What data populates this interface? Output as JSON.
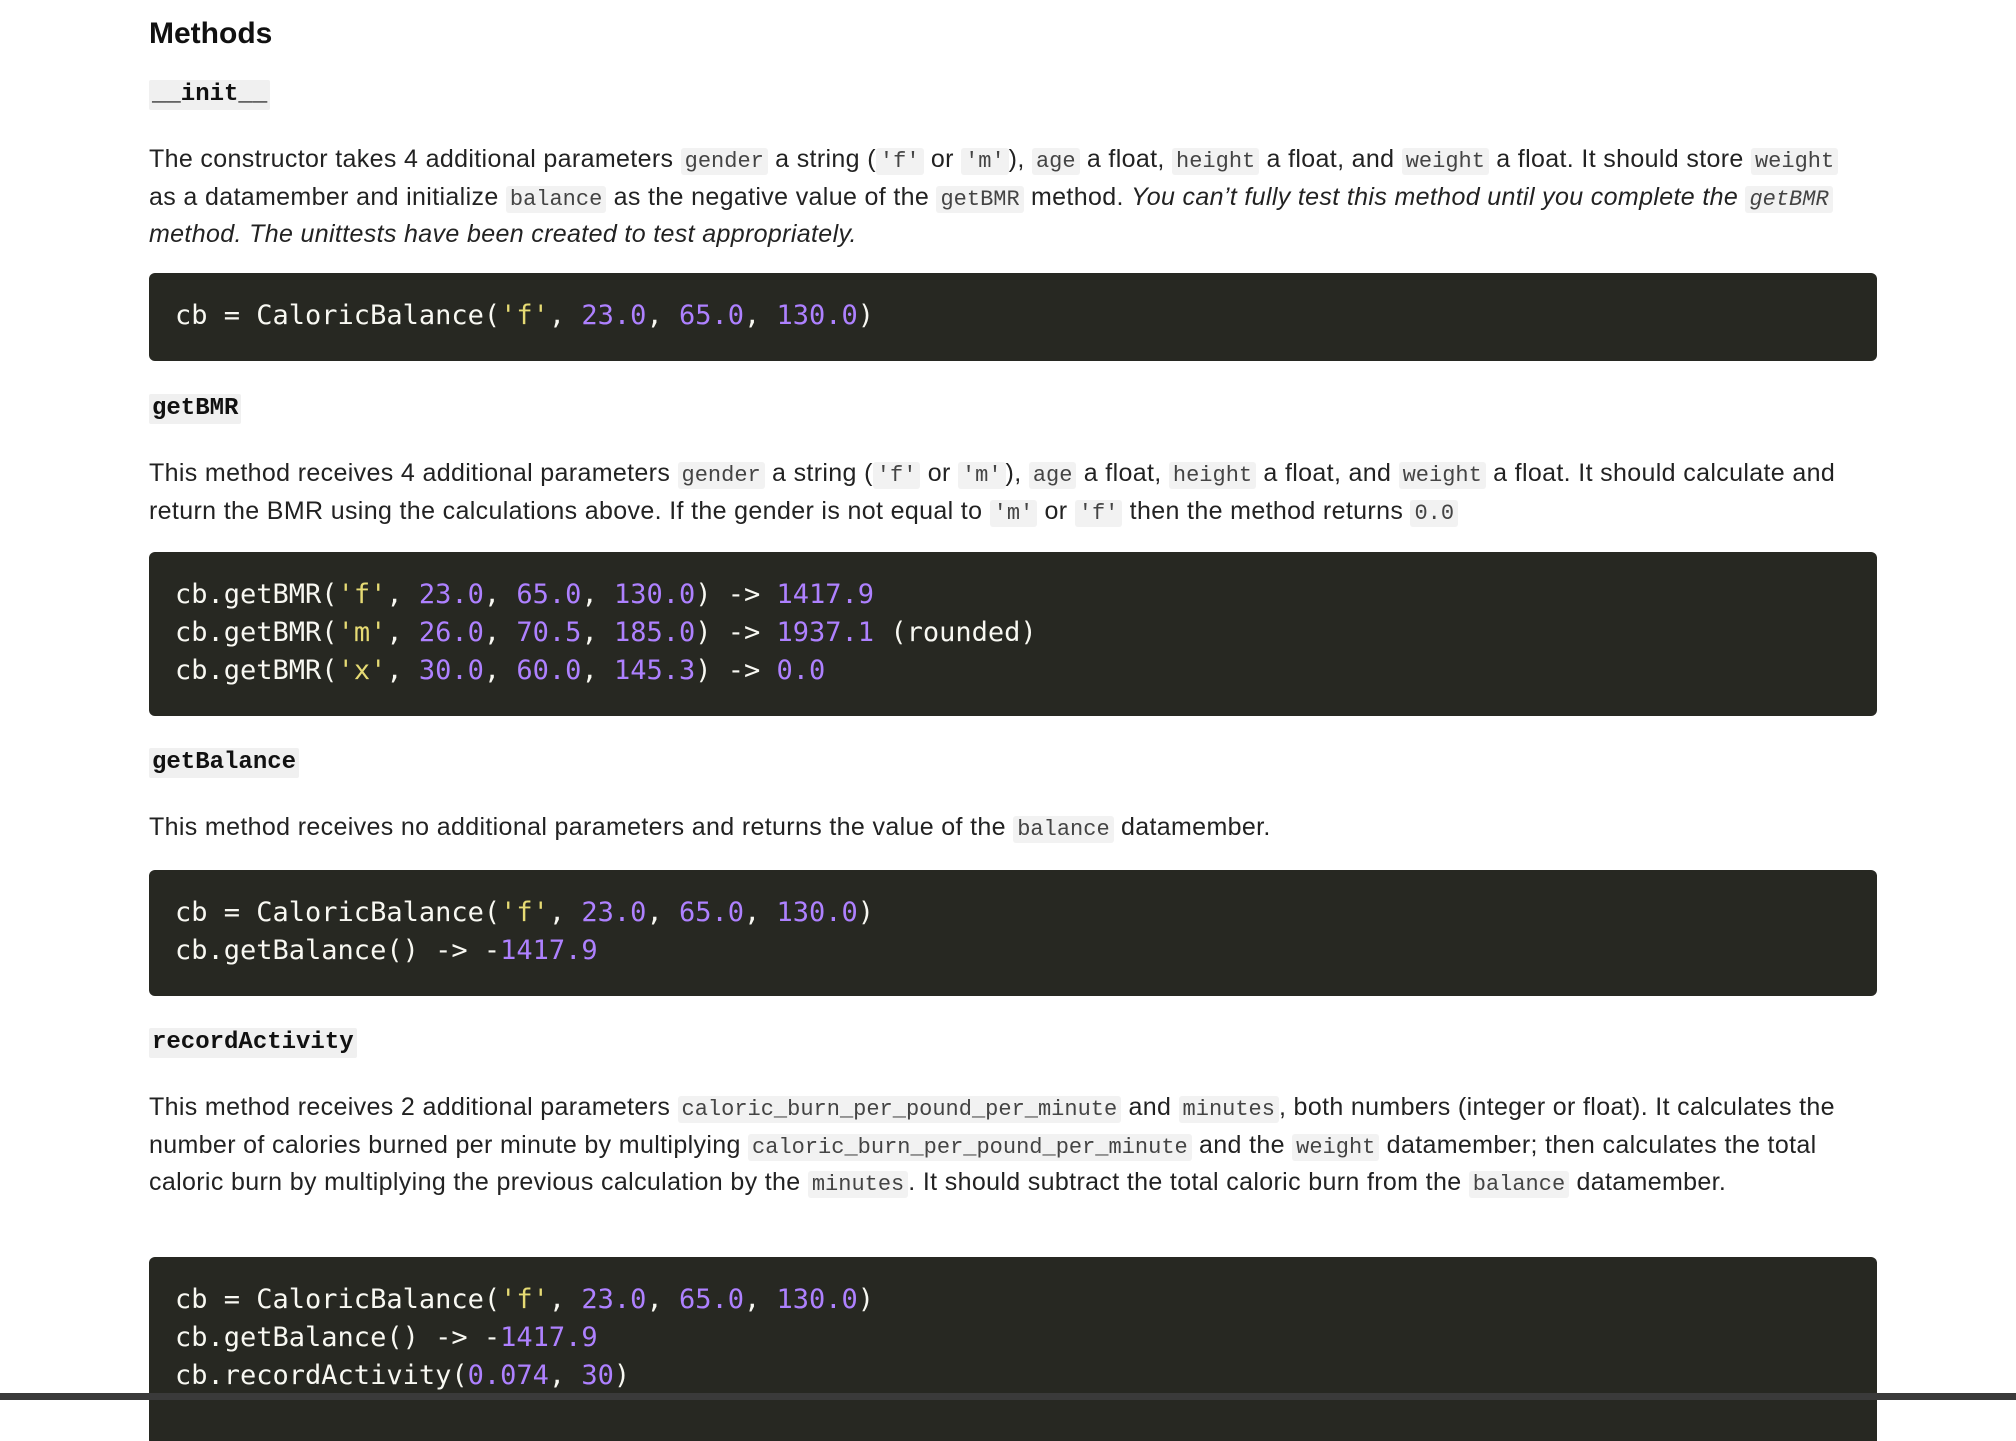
{
  "heading": "Methods",
  "init": {
    "name": "__init__",
    "p": [
      "The constructor takes 4 additional parameters ",
      "gender",
      " a string (",
      "'f'",
      " or ",
      "'m'",
      "), ",
      "age",
      " a float, ",
      "height",
      " a float, and ",
      "weight",
      " a float. It should store ",
      "weight",
      " as a datamember and initialize ",
      "balance",
      " as the negative value of the ",
      "getBMR",
      " method. "
    ],
    "em": [
      "You can’t fully test this method until you complete the ",
      "getBMR",
      " method. The unittests have been created to test appropriately."
    ],
    "code": {
      "l1": {
        "a": "cb = CaloricBalance(",
        "s": "'f'",
        "c1": ", ",
        "n1": "23.0",
        "c2": ", ",
        "n2": "65.0",
        "c3": ", ",
        "n3": "130.0",
        "e": ")"
      }
    }
  },
  "getBMR": {
    "name": "getBMR",
    "p": [
      "This method receives 4 additional parameters ",
      "gender",
      " a string (",
      "'f'",
      " or ",
      "'m'",
      "), ",
      "age",
      " a float, ",
      "height",
      " a float, and ",
      "weight",
      " a float. It should calculate and return the BMR using the calculations above. If the gender is not equal to ",
      "'m'",
      " or ",
      "'f'",
      " then the method returns ",
      "0.0"
    ],
    "code": {
      "l1": {
        "a": "cb.getBMR(",
        "s": "'f'",
        "c1": ", ",
        "n1": "23.0",
        "c2": ", ",
        "n2": "65.0",
        "c3": ", ",
        "n3": "130.0",
        "e": ") -> ",
        "r": "1417.9"
      },
      "l2": {
        "a": "cb.getBMR(",
        "s": "'m'",
        "c1": ", ",
        "n1": "26.0",
        "c2": ", ",
        "n2": "70.5",
        "c3": ", ",
        "n3": "185.0",
        "e": ") -> ",
        "r": "1937.1",
        "t": " (rounded)"
      },
      "l3": {
        "a": "cb.getBMR(",
        "s": "'x'",
        "c1": ", ",
        "n1": "30.0",
        "c2": ", ",
        "n2": "60.0",
        "c3": ", ",
        "n3": "145.3",
        "e": ") -> ",
        "r": "0.0"
      }
    }
  },
  "getBalance": {
    "name": "getBalance",
    "p": [
      "This method receives no additional parameters and returns the value of the ",
      "balance",
      " datamember."
    ],
    "code": {
      "l1": {
        "a": "cb = CaloricBalance(",
        "s": "'f'",
        "c1": ", ",
        "n1": "23.0",
        "c2": ", ",
        "n2": "65.0",
        "c3": ", ",
        "n3": "130.0",
        "e": ")"
      },
      "l2": {
        "a": "cb.getBalance() -> -",
        "r": "1417.9"
      }
    }
  },
  "recordActivity": {
    "name": "recordActivity",
    "p": [
      "This method receives 2 additional parameters ",
      "caloric_burn_per_pound_per_minute",
      " and ",
      "minutes",
      ", both numbers (integer or float). It calculates the number of calories burned per minute by multiplying ",
      "caloric_burn_per_pound_per_minute",
      " and the ",
      "weight",
      " datamember; then calculates the total caloric burn by multiplying the previous calculation by the ",
      "minutes",
      ". It should subtract the total caloric burn from the ",
      "balance",
      " datamember."
    ],
    "code": {
      "l1": {
        "a": "cb = CaloricBalance(",
        "s": "'f'",
        "c1": ", ",
        "n1": "23.0",
        "c2": ", ",
        "n2": "65.0",
        "c3": ", ",
        "n3": "130.0",
        "e": ")"
      },
      "l2": {
        "a": "cb.getBalance() -> -",
        "r": "1417.9"
      },
      "l3": {
        "a": "cb.recordActivity(",
        "n1": "0.074",
        "c1": ", ",
        "n2": "30",
        "e": ")"
      }
    }
  },
  "colors": {
    "code_bg": "#272822",
    "code_text": "#f8f8f2",
    "string": "#e6db74",
    "number": "#ae81ff",
    "inline_code_bg": "#f2f2f2"
  }
}
